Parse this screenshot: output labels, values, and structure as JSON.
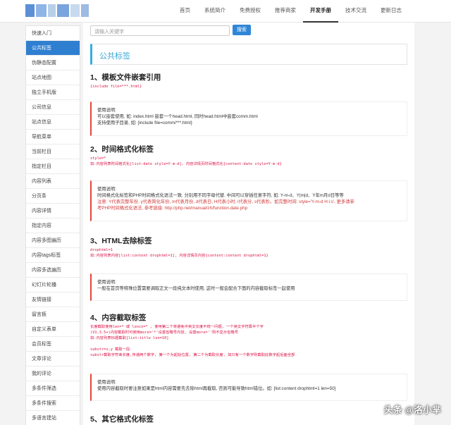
{
  "header": {
    "logo_colors": [
      "#5b8fd6",
      "#8fb5e6",
      "#b7cfe8",
      "#7aa4dd",
      "#c9d9ee",
      "#9dbbe3"
    ],
    "nav": [
      {
        "label": "首页",
        "active": false
      },
      {
        "label": "系统简介",
        "active": false
      },
      {
        "label": "免费授权",
        "active": false
      },
      {
        "label": "推荐商家",
        "active": false
      },
      {
        "label": "开发手册",
        "active": true
      },
      {
        "label": "技术交流",
        "active": false
      },
      {
        "label": "更新日志",
        "active": false
      }
    ]
  },
  "sidebar": {
    "items": [
      {
        "label": "快速入门",
        "active": false
      },
      {
        "label": "公共标签",
        "active": true
      },
      {
        "label": "伪静态配置",
        "active": false
      },
      {
        "label": "站点地图",
        "active": false
      },
      {
        "label": "独立手机版",
        "active": false
      },
      {
        "label": "公司信息",
        "active": false
      },
      {
        "label": "站点信息",
        "active": false
      },
      {
        "label": "导航菜单",
        "active": false
      },
      {
        "label": "当前栏目",
        "active": false
      },
      {
        "label": "指定栏目",
        "active": false
      },
      {
        "label": "内容列表",
        "active": false
      },
      {
        "label": "分页条",
        "active": false
      },
      {
        "label": "内容详情",
        "active": false
      },
      {
        "label": "指定内容",
        "active": false
      },
      {
        "label": "内容多图遍历",
        "active": false
      },
      {
        "label": "内容tags标签",
        "active": false
      },
      {
        "label": "内容多选遍历",
        "active": false
      },
      {
        "label": "幻灯片轮播",
        "active": false
      },
      {
        "label": "友情链接",
        "active": false
      },
      {
        "label": "留言板",
        "active": false
      },
      {
        "label": "自定义表单",
        "active": false
      },
      {
        "label": "会员标签",
        "active": false
      },
      {
        "label": "文章评论",
        "active": false
      },
      {
        "label": "我的评论",
        "active": false
      },
      {
        "label": "多条件筛选",
        "active": false
      },
      {
        "label": "多条件搜索",
        "active": false
      },
      {
        "label": "多语言建站",
        "active": false
      }
    ]
  },
  "search": {
    "placeholder": "请输入关键字",
    "button": "搜索"
  },
  "page_title": "公共标签",
  "sections": [
    {
      "title": "1、模板文件嵌套引用",
      "code": [
        "{include file=***.html}"
      ]
    },
    {
      "title": "2、时间格式化标签",
      "code": [
        "style=*",
        "如:内容列表时间格式化[list:date style=Y-m-d], 内容详情页时间格式化{content:date style=Y-m-d}"
      ]
    },
    {
      "title": "3、HTML去除标签",
      "code": [
        "drophtml=1",
        "如:内容列表内容[list:content drophtml=1], 内容详情页内容{content:content drophtml=1}"
      ]
    },
    {
      "title": "4、内容截取标签",
      "code": [
        "长度截取使用len=* 或 lencn=* , 使用第二个将避免中英文长度不统一问题, 一个英文字符算半个字",
        "(V1.3.5+)内容截取时可使用more='*'设置省略号内容, 设置more=''则不显示省略号",
        "如:内容列表标题截取[list:title len=10]",
        "",
        "substr=x,y 截取一段",
        "substr截取字符串长度,传递两个数字, 第一个为起始位置, 第二个为截取长度, 如只有一个数字则截取此数字起后面全部"
      ]
    },
    {
      "title": "5、其它格式化标签",
      "code": []
    }
  ],
  "notes": [
    {
      "lines": [
        {
          "text": "使用说明:",
          "red": false
        },
        {
          "text": "可以嵌套使用, 如: index.html 嵌套一个head.html, 同时head.html中嵌套comm.html",
          "red": false
        },
        {
          "text": "支持使用子目录, 如: {include file=comm/***.html}",
          "red": false
        }
      ]
    },
    {
      "lines": [
        {
          "text": "使用说明:",
          "red": false
        },
        {
          "text": "时间格式化标签和PHP时间格式化语法一致, 分别用不同字母代替, 中间可以穿插任意字符, 如: Y-m-d、Y|m|d、Y年m月d日等等",
          "red": false
        },
        {
          "text": "注意: Y代表完整年份, y代表简化年份, m代表月份, d代表日, H代表小时, i代表分, s代表秒。如完整时间: style='Y-m-d H:i:s', 更多请参",
          "red": true
        },
        {
          "text": "考PHP时间格式化语法, 参考链接: http://php.net/manual/zh/function.date.php",
          "red": true
        }
      ]
    },
    {
      "lines": [
        {
          "text": "使用说明:",
          "red": false
        },
        {
          "text": "一般在首页等特殊位置需要调取正文一段纯文本时使用, 这时一般会配合下面的内容截取标签一起使用",
          "red": false
        }
      ]
    },
    {
      "lines": [
        {
          "text": "使用说明:",
          "red": false
        },
        {
          "text": "使用内容截取时要注意如果是html内容需要先去除html再截取, 否则可能导致html错位。如: [list:content drophtml=1 len=50]",
          "red": false
        }
      ]
    }
  ],
  "watermark": "头条 @洛小芈"
}
